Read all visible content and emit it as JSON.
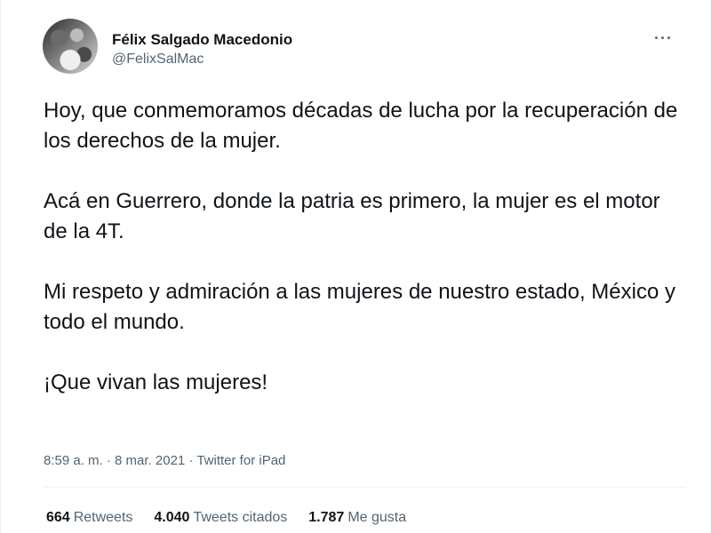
{
  "author": {
    "display_name": "Félix Salgado Macedonio",
    "handle": "@FelixSalMac"
  },
  "more_icon": "ellipsis-icon",
  "tweet": {
    "paragraphs": [
      "Hoy, que conmemoramos décadas de lucha por la recuperación de los derechos de la mujer.",
      "Acá en Guerrero, donde la patria es primero, la mujer es el motor de la 4T.",
      "Mi respeto y admiración a las mujeres de nuestro estado, México y todo el mundo.",
      "¡Que vivan las mujeres!"
    ],
    "time": "8:59 a. m.",
    "separator": "·",
    "date": "8 mar. 2021",
    "source": "Twitter for iPad"
  },
  "stats": {
    "retweets_count": "664",
    "retweets_label": "Retweets",
    "quotes_count": "4.040",
    "quotes_label": "Tweets citados",
    "likes_count": "1.787",
    "likes_label": "Me gusta"
  },
  "colors": {
    "text": "#0f1419",
    "secondary": "#536471",
    "divider": "#eff3f4"
  }
}
